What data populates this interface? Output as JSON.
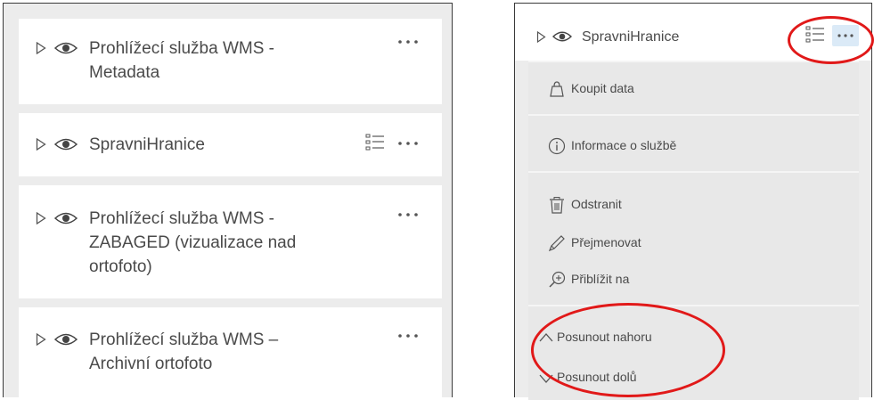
{
  "left_panel": {
    "layers": [
      {
        "title_lines": [
          "Prohlížecí služba WMS -",
          "Metadata"
        ],
        "has_legend": false
      },
      {
        "title_lines": [
          "SpravniHranice"
        ],
        "has_legend": true
      },
      {
        "title_lines": [
          "Prohlížecí služba WMS -",
          "ZABAGED (vizualizace nad",
          "ortofoto)"
        ],
        "has_legend": false
      },
      {
        "title_lines": [
          "Prohlížecí služba WMS –",
          "Archivní ortofoto"
        ],
        "has_legend": false
      }
    ]
  },
  "right_panel": {
    "layer_title": "SpravniHranice",
    "menu": {
      "buy": "Koupit data",
      "info": "Informace o službě",
      "remove": "Odstranit",
      "rename": "Přejmenovat",
      "zoom": "Přiblížit na",
      "move_up": "Posunout nahoru",
      "move_down": "Posunout dolů"
    }
  },
  "colors": {
    "annotation": "#e11919",
    "active_button": "#dbeaf7",
    "panel_bg": "#ececec"
  },
  "icons": [
    "caret-right-icon",
    "eye-icon",
    "legend-list-icon",
    "more-options-icon",
    "shopping-bag-icon",
    "info-icon",
    "trash-icon",
    "pencil-icon",
    "zoom-in-icon",
    "chevron-up-icon",
    "chevron-down-icon"
  ]
}
